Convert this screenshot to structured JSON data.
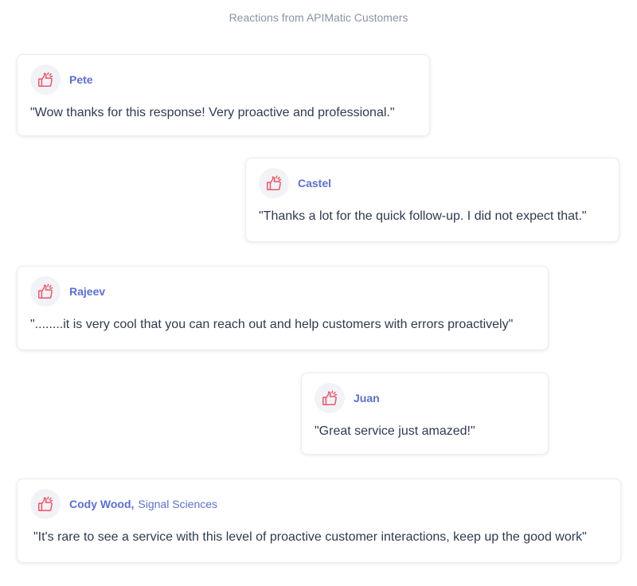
{
  "header": {
    "title": "Reactions from APIMatic Customers"
  },
  "colors": {
    "accent": "#5b6fd6",
    "icon": "#ef5366",
    "text": "#2f3a4f",
    "muted": "#8a93a6"
  },
  "reactions": [
    {
      "author": "Pete",
      "company": "",
      "quote": "\"Wow thanks for this response! Very proactive and professional.\"",
      "icon": "thumbs-up-icon"
    },
    {
      "author": "Castel",
      "company": "",
      "quote": "\"Thanks a lot for the quick follow-up. I did not expect that.\"",
      "icon": "thumbs-up-icon"
    },
    {
      "author": "Rajeev",
      "company": "",
      "quote": "\"........it is very cool that you can reach out and help customers with errors proactively\"",
      "icon": "thumbs-up-icon"
    },
    {
      "author": "Juan",
      "company": "",
      "quote": "\"Great service just amazed!\"",
      "icon": "thumbs-up-icon"
    },
    {
      "author": "Cody Wood,",
      "company": "Signal Sciences",
      "quote": "\"It's rare to see a service with this level of proactive customer interactions, keep up the good work\"",
      "icon": "thumbs-up-icon"
    }
  ]
}
